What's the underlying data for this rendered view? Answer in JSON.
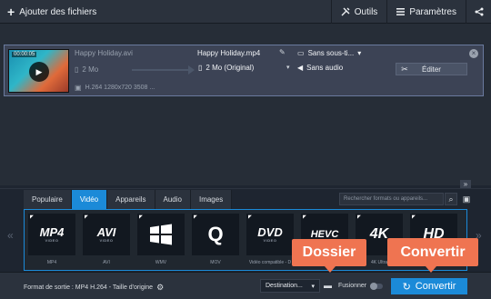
{
  "toolbar": {
    "add_files": "Ajouter des fichiers",
    "tools": "Outils",
    "settings": "Paramètres"
  },
  "file": {
    "thumb_time": "00:00:05",
    "source_name": "Happy Holiday.avi",
    "source_size": "2 Mo",
    "source_info": "H.264 1280x720 3508 ...",
    "output_name": "Happy Holiday.mp4",
    "output_size": "2 Mo (Original)",
    "subtitles": "Sans sous-ti...",
    "audio": "Sans audio",
    "edit_label": "Éditer"
  },
  "tabs": [
    {
      "label": "Populaire"
    },
    {
      "label": "Vidéo"
    },
    {
      "label": "Appareils"
    },
    {
      "label": "Audio"
    },
    {
      "label": "Images"
    }
  ],
  "active_tab": "Vidéo",
  "search": {
    "placeholder": "Rechercher formats ou appareils..."
  },
  "formats": [
    {
      "logo": "MP4",
      "sub": "VIDEO",
      "label": "MP4"
    },
    {
      "logo": "AVI",
      "sub": "VIDEO",
      "label": "AVI"
    },
    {
      "logo": "",
      "sub": "",
      "label": "WMV"
    },
    {
      "logo": "Q",
      "sub": "",
      "label": "MOV"
    },
    {
      "logo": "DVD",
      "sub": "VIDEO",
      "label": "Vidéo compatible - D"
    },
    {
      "logo": "HEVC",
      "sub": "",
      "label": ""
    },
    {
      "logo": "4K",
      "sub": "",
      "label": "4K Ultra"
    },
    {
      "logo": "HD",
      "sub": "",
      "label": ""
    }
  ],
  "bottom": {
    "output_format": "Format de sortie : MP4 H.264 - Taille d'origine",
    "destination": "Destination...",
    "merge": "Fusionner",
    "convert": "Convertir"
  },
  "callouts": {
    "folder": "Dossier",
    "convert": "Convertir"
  },
  "colors": {
    "accent": "#1b8ad8",
    "callout": "#ef7451"
  }
}
